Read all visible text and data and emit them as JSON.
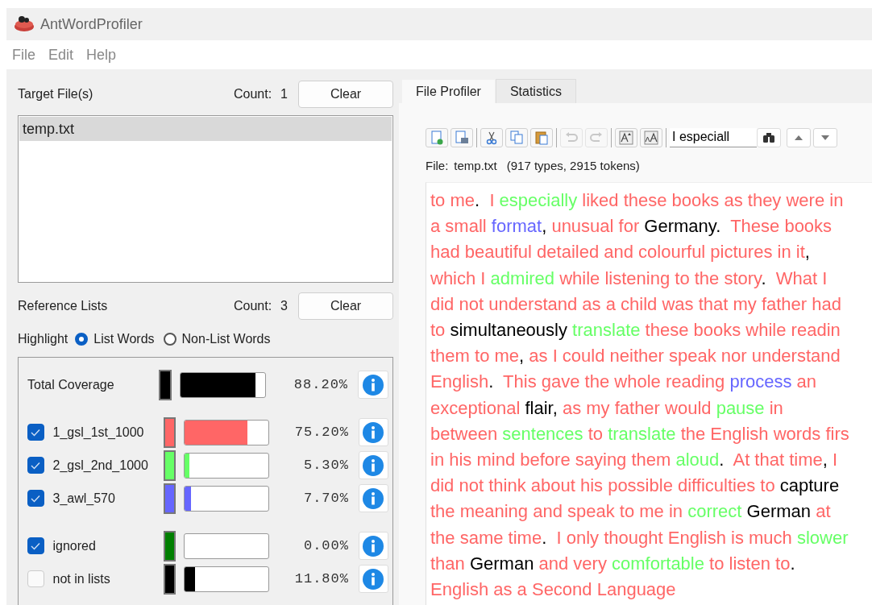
{
  "window": {
    "title": "AntWordProfiler"
  },
  "menu": [
    "File",
    "Edit",
    "Help"
  ],
  "target_files": {
    "label": "Target File(s)",
    "count_label": "Count:",
    "count": "1",
    "clear": "Clear",
    "files": [
      {
        "name": "temp.txt",
        "selected": true
      }
    ]
  },
  "reference_lists": {
    "label": "Reference Lists",
    "count_label": "Count:",
    "count": "3",
    "clear": "Clear"
  },
  "highlight": {
    "label": "Highlight",
    "options": [
      {
        "label": "List Words",
        "selected": true
      },
      {
        "label": "Non-List Words",
        "selected": false
      }
    ]
  },
  "coverage": [
    {
      "kind": "total",
      "name": "Total Coverage",
      "color": "#000000",
      "level": 0.882,
      "percent": "88.20%"
    },
    {
      "kind": "list",
      "name": "1_gsl_1st_1000",
      "checked": true,
      "color": "#ff6666",
      "level": 0.752,
      "percent": "75.20%"
    },
    {
      "kind": "list",
      "name": "2_gsl_2nd_1000",
      "checked": true,
      "color": "#66ff66",
      "level": 0.053,
      "percent": "5.30%"
    },
    {
      "kind": "list",
      "name": "3_awl_570",
      "checked": true,
      "color": "#6666ff",
      "level": 0.077,
      "percent": "7.70%"
    },
    {
      "kind": "extra",
      "name": "ignored",
      "checked": true,
      "color": "#007f00",
      "level": 0,
      "percent": "0.00%"
    },
    {
      "kind": "extra",
      "name": "not in lists",
      "checked": false,
      "color": "#000000",
      "level": 0.118,
      "percent": "11.80%"
    }
  ],
  "tabs": [
    {
      "label": "File Profiler",
      "selected": true
    },
    {
      "label": "Statistics",
      "selected": false
    }
  ],
  "toolbar": [
    {
      "kind": "new",
      "disabled": false
    },
    {
      "kind": "save",
      "disabled": false
    },
    {
      "kind": "cut",
      "disabled": false
    },
    {
      "kind": "copy",
      "disabled": false
    },
    {
      "kind": "paste",
      "disabled": false
    },
    {
      "kind": "undo",
      "disabled": true
    },
    {
      "kind": "redo",
      "disabled": true
    },
    {
      "kind": "bigger",
      "disabled": false
    },
    {
      "kind": "smaller",
      "disabled": false
    }
  ],
  "search": {
    "value": "I especiall"
  },
  "file_info": {
    "label": "File:",
    "name": "temp.txt",
    "stats": "(917 types, 2915 tokens)"
  },
  "text_lines": [
    [
      {
        "text": "to me",
        "kind": "gsl1"
      },
      {
        "text": ".  ",
        "kind": "none"
      },
      {
        "text": "I ",
        "kind": "gsl1"
      },
      {
        "text": "especially",
        "kind": "gsl2"
      },
      {
        "text": " liked these books as they were in",
        "kind": "gsl1"
      }
    ],
    [
      {
        "text": "a small ",
        "kind": "gsl1"
      },
      {
        "text": "format",
        "kind": "awl"
      },
      {
        "text": ", ",
        "kind": "none"
      },
      {
        "text": "unusual for ",
        "kind": "gsl1"
      },
      {
        "text": "Germany.  ",
        "kind": "none"
      },
      {
        "text": "These books",
        "kind": "gsl1"
      }
    ],
    [
      {
        "text": "had beautiful detailed and colourful pictures in it",
        "kind": "gsl1"
      },
      {
        "text": ",",
        "kind": "none"
      }
    ],
    [
      {
        "text": "which I ",
        "kind": "gsl1"
      },
      {
        "text": "admired",
        "kind": "gsl2"
      },
      {
        "text": " while listening to the story",
        "kind": "gsl1"
      },
      {
        "text": ".  ",
        "kind": "none"
      },
      {
        "text": "What I",
        "kind": "gsl1"
      }
    ],
    [
      {
        "text": "did not understand as a child was that my father had",
        "kind": "gsl1"
      }
    ],
    [
      {
        "text": "to ",
        "kind": "gsl1"
      },
      {
        "text": "simultaneously ",
        "kind": "none"
      },
      {
        "text": "translate",
        "kind": "gsl2"
      },
      {
        "text": " these books while readin",
        "kind": "gsl1"
      }
    ],
    [
      {
        "text": "them to me",
        "kind": "gsl1"
      },
      {
        "text": ", ",
        "kind": "none"
      },
      {
        "text": "as I could neither speak nor understand",
        "kind": "gsl1"
      }
    ],
    [
      {
        "text": "English",
        "kind": "gsl1"
      },
      {
        "text": ".  ",
        "kind": "none"
      },
      {
        "text": "This gave the whole reading ",
        "kind": "gsl1"
      },
      {
        "text": "process",
        "kind": "awl"
      },
      {
        "text": " an",
        "kind": "gsl1"
      }
    ],
    [
      {
        "text": "exceptional ",
        "kind": "gsl1"
      },
      {
        "text": "flair, ",
        "kind": "none"
      },
      {
        "text": "as my father would ",
        "kind": "gsl1"
      },
      {
        "text": "pause",
        "kind": "gsl2"
      },
      {
        "text": " in",
        "kind": "gsl1"
      }
    ],
    [
      {
        "text": "between ",
        "kind": "gsl1"
      },
      {
        "text": "sentences",
        "kind": "gsl2"
      },
      {
        "text": " to ",
        "kind": "gsl1"
      },
      {
        "text": "translate",
        "kind": "gsl2"
      },
      {
        "text": " the English words firs",
        "kind": "gsl1"
      }
    ],
    [
      {
        "text": "in his mind before saying them ",
        "kind": "gsl1"
      },
      {
        "text": "aloud",
        "kind": "gsl2"
      },
      {
        "text": ".  ",
        "kind": "none"
      },
      {
        "text": "At that time",
        "kind": "gsl1"
      },
      {
        "text": ", ",
        "kind": "none"
      },
      {
        "text": "I",
        "kind": "gsl1"
      }
    ],
    [
      {
        "text": "did not think about his possible difficulties to ",
        "kind": "gsl1"
      },
      {
        "text": "capture",
        "kind": "none"
      }
    ],
    [
      {
        "text": "the meaning and speak to me in ",
        "kind": "gsl1"
      },
      {
        "text": "correct",
        "kind": "gsl2"
      },
      {
        "text": " German ",
        "kind": "none"
      },
      {
        "text": "at",
        "kind": "gsl1"
      }
    ],
    [
      {
        "text": "the same time",
        "kind": "gsl1"
      },
      {
        "text": ".  ",
        "kind": "none"
      },
      {
        "text": "I only thought English is much ",
        "kind": "gsl1"
      },
      {
        "text": "slower",
        "kind": "gsl2"
      }
    ],
    [
      {
        "text": "than ",
        "kind": "gsl1"
      },
      {
        "text": "German ",
        "kind": "none"
      },
      {
        "text": "and very ",
        "kind": "gsl1"
      },
      {
        "text": "comfortable",
        "kind": "gsl2"
      },
      {
        "text": " to listen to",
        "kind": "gsl1"
      },
      {
        "text": ".",
        "kind": "none"
      }
    ],
    [
      {
        "text": "English as a Second Language",
        "kind": "gsl1"
      }
    ]
  ]
}
